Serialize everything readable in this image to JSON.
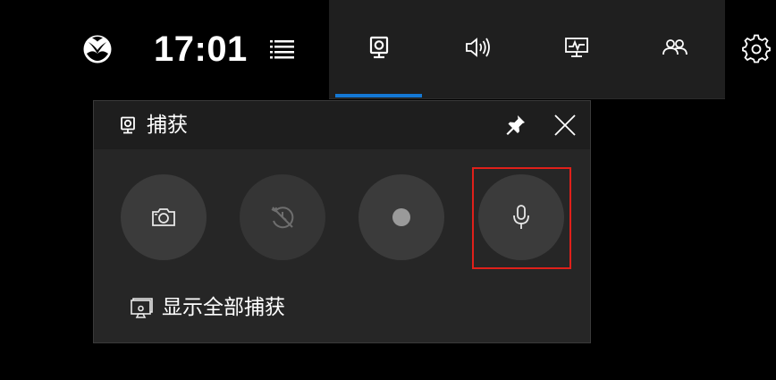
{
  "top_bar": {
    "logo_icon": "xbox-logo-icon",
    "clock": "17:01",
    "menu_icon": "menu-icon"
  },
  "widget_bar": {
    "items": [
      {
        "icon": "capture-widget-icon",
        "selected": true
      },
      {
        "icon": "audio-icon",
        "selected": false
      },
      {
        "icon": "performance-icon",
        "selected": false
      },
      {
        "icon": "social-icon",
        "selected": false
      }
    ],
    "accent_color": "#1478d4"
  },
  "settings_icon": "gear-icon",
  "capture_widget": {
    "title": "捕获",
    "title_icon": "capture-widget-icon",
    "pin_icon": "pin-icon",
    "close_icon": "close-icon",
    "buttons": [
      {
        "icon": "camera-icon",
        "state": "enabled"
      },
      {
        "icon": "record-last-off-icon",
        "state": "disabled"
      },
      {
        "icon": "record-dot-icon",
        "state": "enabled"
      },
      {
        "icon": "microphone-icon",
        "state": "enabled",
        "highlighted": true
      }
    ],
    "show_all_label": "显示全部捕获",
    "show_all_icon": "gallery-icon",
    "highlight_color": "#e0201a"
  }
}
